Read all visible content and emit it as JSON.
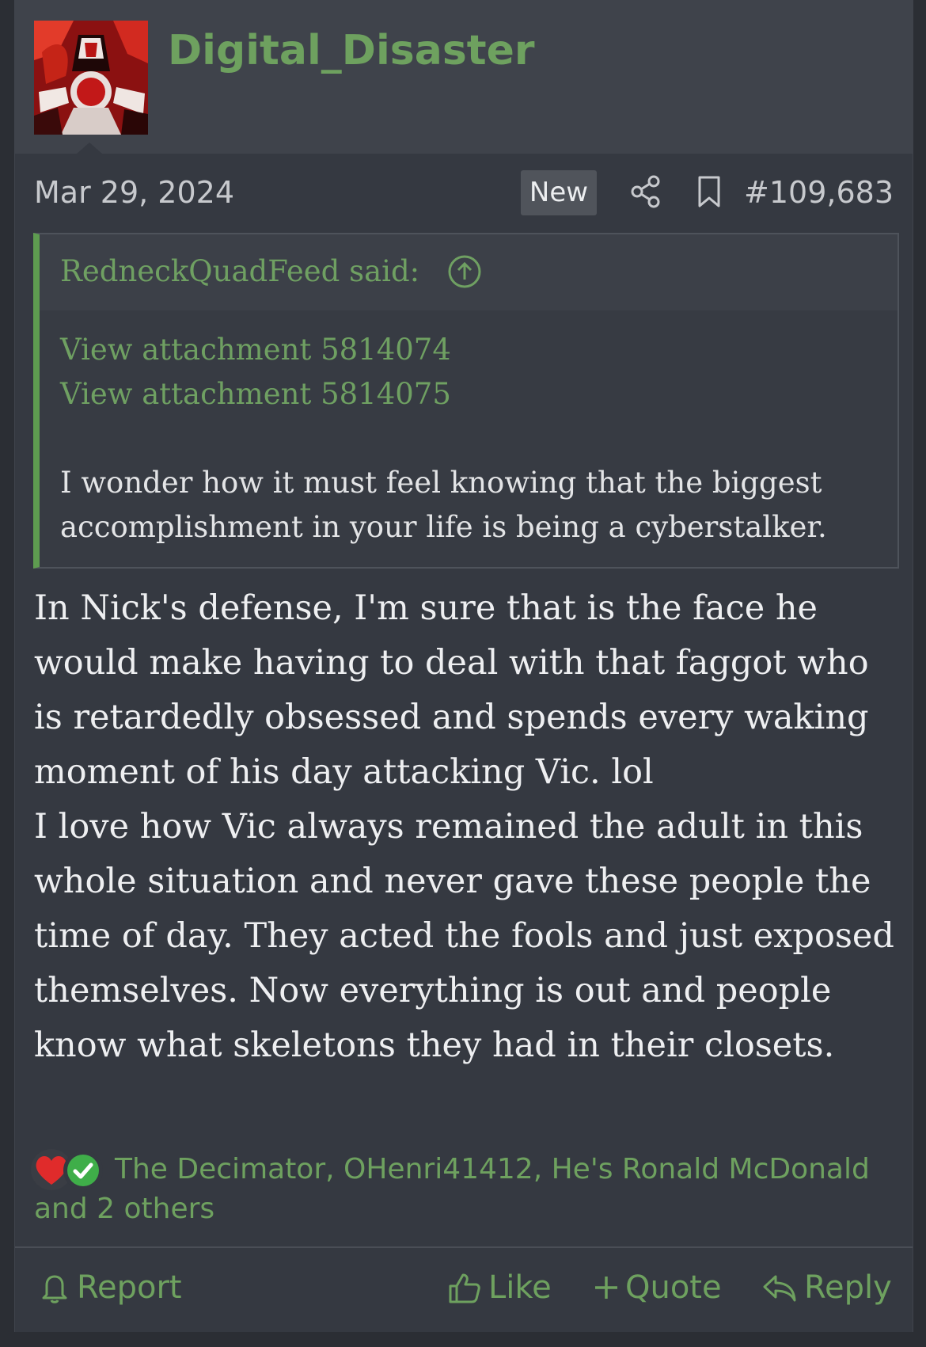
{
  "user": {
    "name": "Digital_Disaster",
    "avatar_icon": "demon-avatar"
  },
  "meta": {
    "date": "Mar 29, 2024",
    "badge": "New",
    "post_number": "#109,683"
  },
  "quote": {
    "author": "RedneckQuadFeed said:",
    "attachments": [
      "View attachment 5814074",
      "View attachment 5814075"
    ],
    "text": "I wonder how it must feel knowing that the biggest accomplishment in your life is being a cyberstalker."
  },
  "body": {
    "paragraphs": [
      "In Nick's defense, I'm sure that is the face he would make having to deal with that faggot who is retardedly obsessed and spends every waking moment of his day attacking Vic. lol",
      "I love how Vic always remained the adult in this whole situation and never gave these people the time of day. They acted the fools and just exposed themselves. Now everything is out and people know what skeletons they had in their closets."
    ]
  },
  "reactions": {
    "text": "The Decimator, OHenri41412, He's Ronald McDonald and 2 others",
    "icons": [
      "heart-icon",
      "check-icon"
    ]
  },
  "actions": {
    "report": "Report",
    "like": "Like",
    "quote": "Quote",
    "reply": "Reply"
  },
  "colors": {
    "accent": "#6ea15f",
    "background": "#353941",
    "header": "#3f434b"
  }
}
